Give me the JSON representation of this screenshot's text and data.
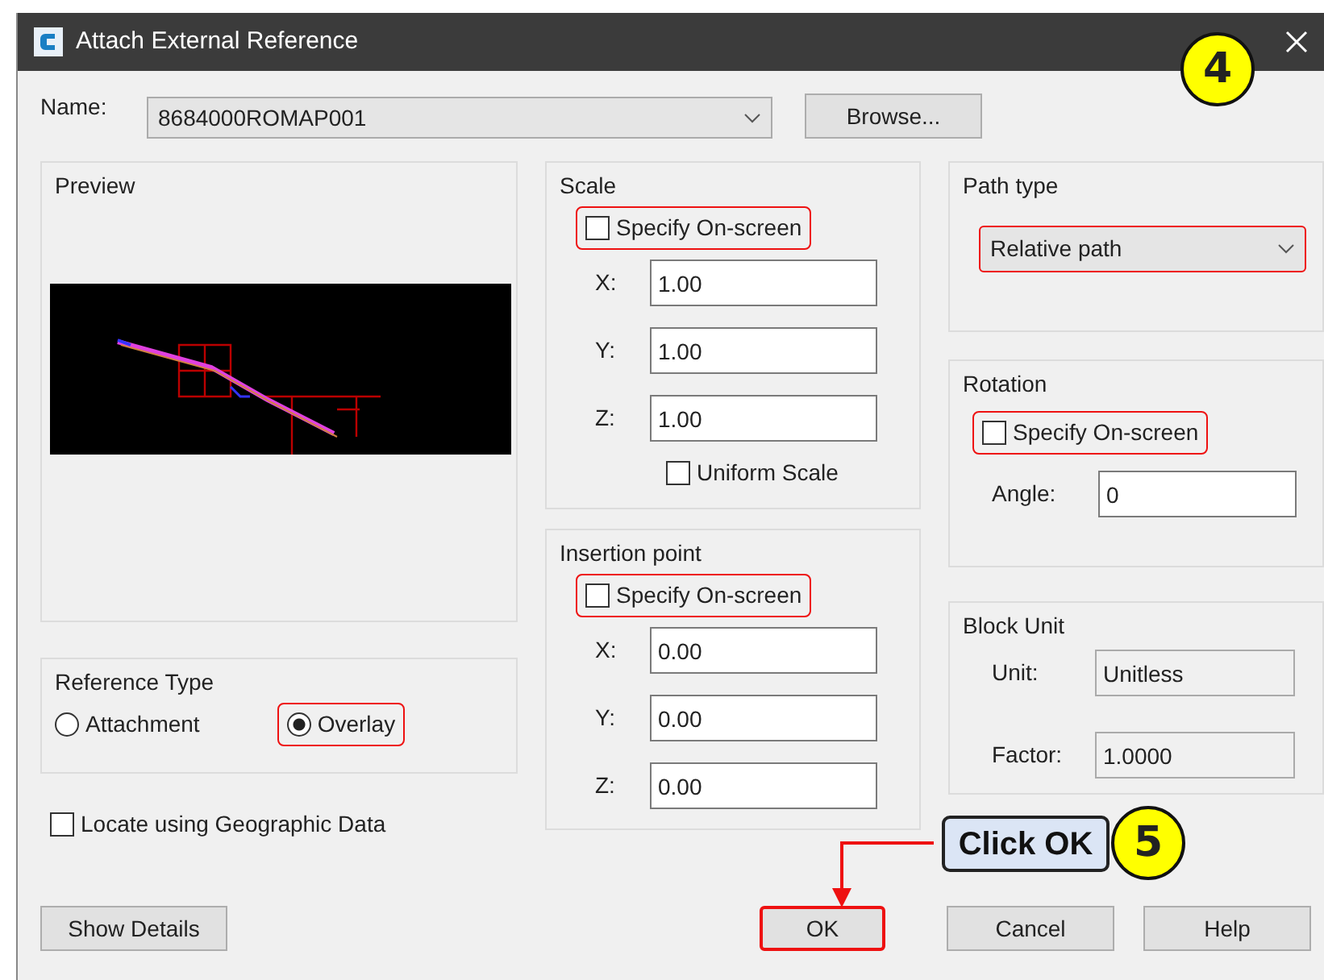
{
  "window": {
    "title": "Attach External Reference"
  },
  "name_field": {
    "label": "Name:",
    "value": "8684000ROMAP001"
  },
  "browse_button": "Browse...",
  "preview": {
    "label": "Preview"
  },
  "reference_type": {
    "label": "Reference Type",
    "options": [
      {
        "label": "Attachment",
        "selected": false,
        "highlighted": false
      },
      {
        "label": "Overlay",
        "selected": true,
        "highlighted": true
      }
    ]
  },
  "locate_geographic": {
    "label": "Locate using Geographic Data",
    "checked": false
  },
  "scale": {
    "label": "Scale",
    "specify_on_screen": {
      "label": "Specify On-screen",
      "checked": false,
      "highlighted": true
    },
    "fields": [
      {
        "label": "X:",
        "value": "1.00"
      },
      {
        "label": "Y:",
        "value": "1.00"
      },
      {
        "label": "Z:",
        "value": "1.00"
      }
    ],
    "uniform_scale": {
      "label": "Uniform Scale",
      "checked": false
    }
  },
  "insertion_point": {
    "label": "Insertion point",
    "specify_on_screen": {
      "label": "Specify On-screen",
      "checked": false,
      "highlighted": true
    },
    "fields": [
      {
        "label": "X:",
        "value": "0.00"
      },
      {
        "label": "Y:",
        "value": "0.00"
      },
      {
        "label": "Z:",
        "value": "0.00"
      }
    ]
  },
  "path_type": {
    "label": "Path type",
    "value": "Relative path",
    "highlighted": true
  },
  "rotation": {
    "label": "Rotation",
    "specify_on_screen": {
      "label": "Specify On-screen",
      "checked": false,
      "highlighted": true
    },
    "angle": {
      "label": "Angle:",
      "value": "0"
    }
  },
  "block_unit": {
    "label": "Block Unit",
    "fields": [
      {
        "label": "Unit:",
        "value": "Unitless"
      },
      {
        "label": "Factor:",
        "value": "1.0000"
      }
    ]
  },
  "buttons": [
    {
      "label": "Show Details",
      "highlighted": false
    },
    {
      "label": "OK",
      "highlighted": true
    },
    {
      "label": "Cancel",
      "highlighted": false
    },
    {
      "label": "Help",
      "highlighted": false
    }
  ],
  "annotations": [
    {
      "kind": "step",
      "label": "4"
    },
    {
      "kind": "callout",
      "label": "Click OK"
    },
    {
      "kind": "step",
      "label": "5"
    }
  ]
}
